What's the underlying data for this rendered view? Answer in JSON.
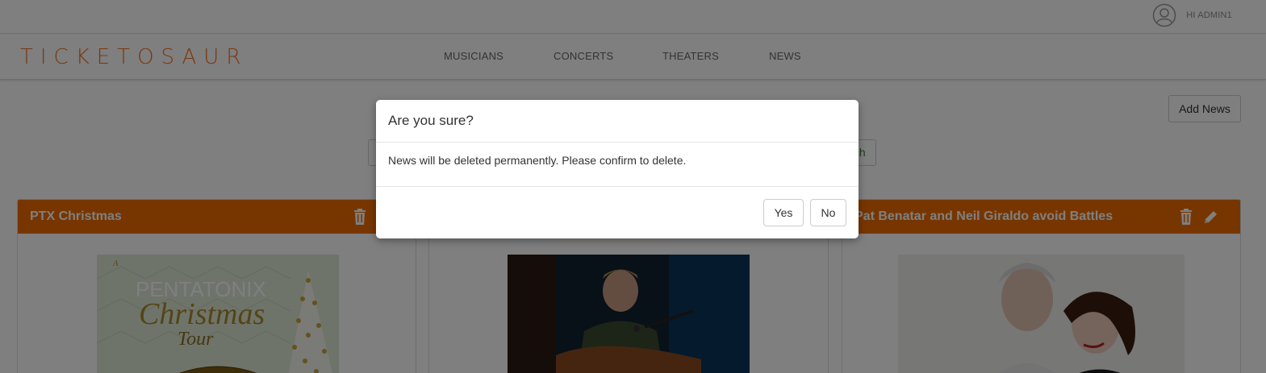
{
  "user": {
    "greeting": "HI ADMIN1",
    "icon": "user-circle-icon"
  },
  "brand": {
    "name": "TICKETOSAUR",
    "color": "#f07020"
  },
  "nav": {
    "items": [
      {
        "label": "MUSICIANS"
      },
      {
        "label": "CONCERTS"
      },
      {
        "label": "THEATERS"
      },
      {
        "label": "NEWS"
      }
    ]
  },
  "toolbar": {
    "add_label": "Add News"
  },
  "search": {
    "value": "",
    "placeholder": "",
    "button_label": "Search"
  },
  "cards": [
    {
      "title": "PTX Christmas",
      "image": "pentatonix-christmas-tour-poster",
      "actions": [
        "trash-icon"
      ]
    },
    {
      "title": "",
      "image": "guitarist-singing-photo",
      "actions": []
    },
    {
      "title": "Pat Benatar and Neil Giraldo avoid Battles",
      "image": "pat-benatar-neil-giraldo-photo",
      "actions": [
        "trash-icon",
        "pencil-icon"
      ]
    }
  ],
  "poster": {
    "line1": "PENTATONIX",
    "line2": "Christmas",
    "line3": "Tour"
  },
  "modal": {
    "title": "Are you sure?",
    "body": "News will be deleted permanently. Please confirm to delete.",
    "yes_label": "Yes",
    "no_label": "No"
  },
  "colors": {
    "accent": "#ee6c00",
    "overlay": "rgba(0,0,0,0.5)"
  }
}
